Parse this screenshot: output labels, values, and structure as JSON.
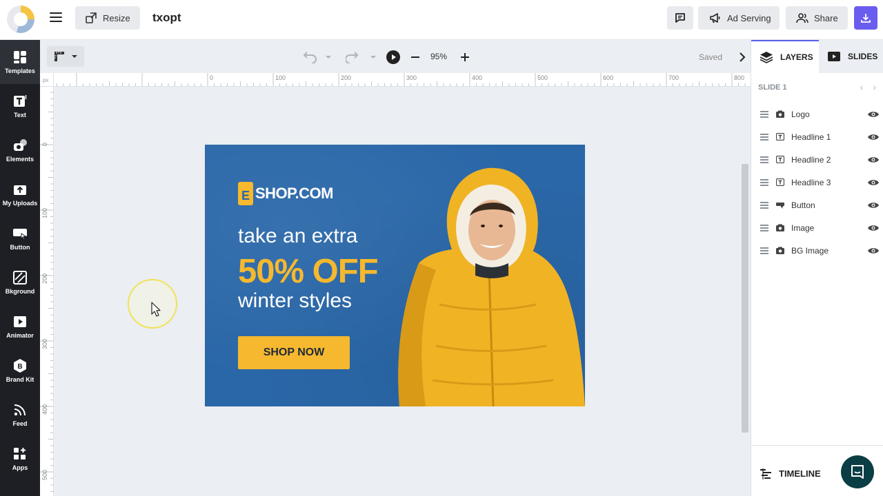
{
  "app": {
    "doc_title": "txopt"
  },
  "topbar": {
    "resize_label": "Resize",
    "ad_serving_label": "Ad Serving",
    "share_label": "Share"
  },
  "sidebar": {
    "items": [
      {
        "label": "Templates",
        "icon": "templates-icon"
      },
      {
        "label": "Text",
        "icon": "text-icon"
      },
      {
        "label": "Elements",
        "icon": "elements-icon"
      },
      {
        "label": "My Uploads",
        "icon": "upload-icon"
      },
      {
        "label": "Button",
        "icon": "button-icon"
      },
      {
        "label": "Bkground",
        "icon": "background-icon"
      },
      {
        "label": "Animator",
        "icon": "animator-icon"
      },
      {
        "label": "Brand Kit",
        "icon": "brand-kit-icon"
      },
      {
        "label": "Feed",
        "icon": "feed-icon"
      },
      {
        "label": "Apps",
        "icon": "apps-icon"
      }
    ]
  },
  "toolbar": {
    "zoom": "95%",
    "status": "Saved"
  },
  "rulers": {
    "unit": "px",
    "h_ticks": [
      "0",
      "100",
      "200",
      "300",
      "400",
      "500",
      "600",
      "700",
      "800"
    ],
    "v_ticks": [
      "0",
      "100",
      "200",
      "300",
      "400",
      "500"
    ]
  },
  "banner": {
    "brand_initial": "E",
    "brand_name": "SHOP.COM",
    "headline1": "take an extra",
    "headline2": "50% OFF",
    "headline3": "winter styles",
    "button": "SHOP NOW",
    "colors": {
      "background": "#2a67a8",
      "accent": "#f5b82e"
    }
  },
  "panel": {
    "tabs": {
      "layers": "LAYERS",
      "slides": "SLIDES"
    },
    "slide_header": "SLIDE 1",
    "layers": [
      {
        "name": "Logo",
        "type": "image"
      },
      {
        "name": "Headline 1",
        "type": "text"
      },
      {
        "name": "Headline 2",
        "type": "text"
      },
      {
        "name": "Headline 3",
        "type": "text"
      },
      {
        "name": "Button",
        "type": "button"
      },
      {
        "name": "Image",
        "type": "image"
      },
      {
        "name": "BG Image",
        "type": "image"
      }
    ],
    "timeline_label": "TIMELINE"
  }
}
